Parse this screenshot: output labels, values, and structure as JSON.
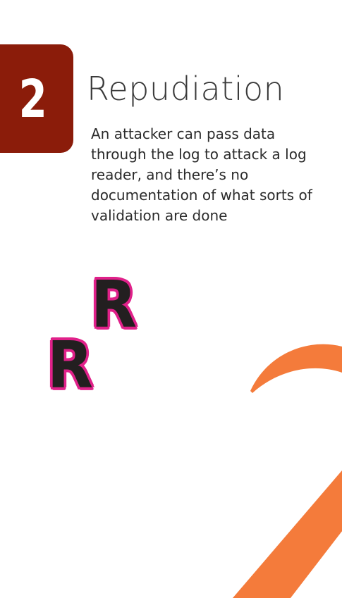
{
  "card": {
    "rank": "2",
    "title": "Repudiation",
    "description": "An attacker can pass data through the log to attack a log reader, and there’s no documentation of what sorts of validation are done",
    "suit_letter": "R",
    "corner_rank_glyph": "2"
  },
  "colors": {
    "badge_background": "#8b1c0a",
    "suit_outline": "#e0218a",
    "corner_numeral": "#f47b3b",
    "title_text": "#3a3a3a",
    "body_text": "#2b2b2b"
  },
  "icons": {
    "corner_numeral": "large-number-two"
  }
}
